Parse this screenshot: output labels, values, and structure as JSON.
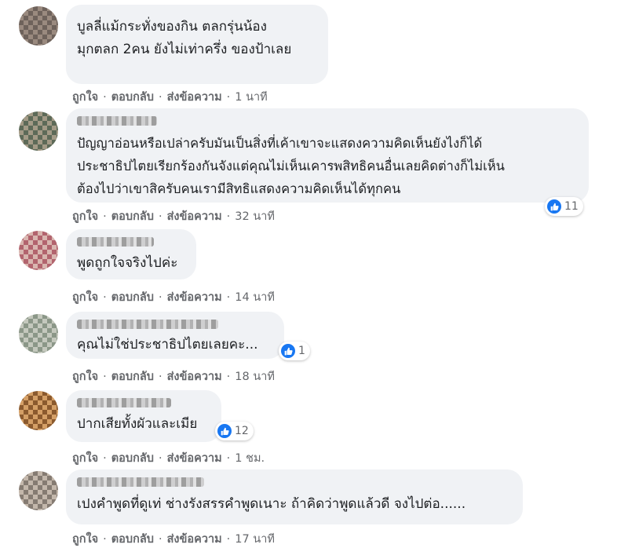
{
  "actions": {
    "like": "ถูกใจ",
    "reply": "ตอบกลับ",
    "message": "ส่งข้อความ",
    "separator": "·"
  },
  "comments": [
    {
      "text": "บูลลี่แม้กระทั่งของกิน ตลกรุ่นน้อง\nมุกตลก 2คน ยังไม่เท่าครึ่ง ของป้าเลย",
      "time": "1 นาที",
      "likes": ""
    },
    {
      "text": "ปัญญาอ่อนหรือเปล่าครับมันเป็นสิ่งที่เค้าเขาจะแสดงความคิดเห็นยังไงก็ได้\nประชาธิปไตยเรียกร้องกันจังแต่คุณไม่เห็นเคารพสิทธิคนอื่นเลยคิดต่างก็ไม่เห็น\nต้องไปว่าเขาสิครับคนเรามีสิทธิแสดงความคิดเห็นได้ทุกคน",
      "time": "32 นาที",
      "likes": "11"
    },
    {
      "text": "พูดถูกใจจริงไปค่ะ",
      "time": "14 นาที",
      "likes": ""
    },
    {
      "text": "คุณไม่ใช่ประชาธิปไตยเลยคะ...",
      "time": "18 นาที",
      "likes": "1"
    },
    {
      "text": "ปากเสียทั้งผัวและเมีย",
      "time": "1 ชม.",
      "likes": "12"
    },
    {
      "text": "เปงคำพูดที่ดูเท่ ช่างรังสรรคำพูดเนาะ ถ้าคิดว่าพูดแล้วดี จงไปต่อ......",
      "time": "17 นาที",
      "likes": ""
    }
  ],
  "colors": {
    "bubble": "#f0f2f5",
    "meta": "#65676b",
    "text": "#1c1e21",
    "like": "#1877f2"
  },
  "icons": {
    "reaction": "thumbs-up-icon"
  }
}
